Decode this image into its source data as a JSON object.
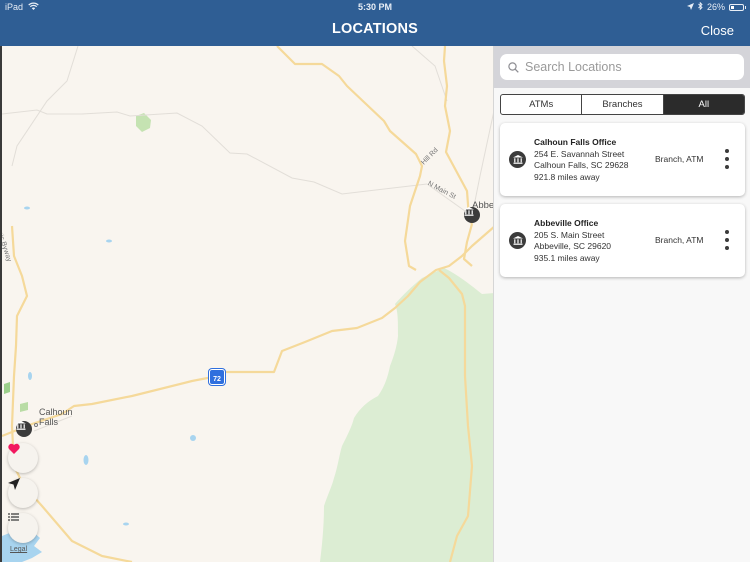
{
  "status_bar": {
    "device": "iPad",
    "time": "5:30 PM",
    "battery": "26%",
    "battery_level": 0.26,
    "icons": [
      "wifi-icon",
      "location-arrow-icon",
      "bluetooth-icon",
      "battery-icon"
    ]
  },
  "header": {
    "title": "LOCATIONS",
    "close_label": "Close"
  },
  "map": {
    "labels": {
      "abbeville": "Abbe",
      "calhoun_line1": "Calhoun",
      "calhoun_line2": "Falls",
      "hill_rd": "Hill Rd",
      "n_main_st": "N Main St",
      "scenic_byway": "Scenic Byway",
      "route_number": "72"
    },
    "legal_label": "Legal",
    "buttons": [
      "favorites",
      "current-location",
      "list"
    ],
    "colors": {
      "land": "#f9f5ef",
      "park": "#dcedd3",
      "road": "#f5d99a",
      "water": "#a8d4ef",
      "favorite": "#f2185f",
      "route_shield": "#2f6fde"
    }
  },
  "panel": {
    "search": {
      "placeholder": "Search Locations",
      "value": ""
    },
    "filters": [
      {
        "label": "ATMs",
        "active": false
      },
      {
        "label": "Branches",
        "active": false
      },
      {
        "label": "All",
        "active": true
      }
    ],
    "locations": [
      {
        "name": "Calhoun Falls Office",
        "street": "254 E. Savannah Street",
        "city": "Calhoun Falls, SC 29628",
        "distance": "921.8 miles away",
        "types": "Branch, ATM"
      },
      {
        "name": "Abbeville Office",
        "street": "205 S. Main Street",
        "city": "Abbeville, SC 29620",
        "distance": "935.1 miles away",
        "types": "Branch, ATM"
      }
    ]
  },
  "theme": {
    "header_bg": "#2f5e94",
    "panel_bg": "#f8f8f8",
    "segment_active": "#2b2b2b"
  }
}
